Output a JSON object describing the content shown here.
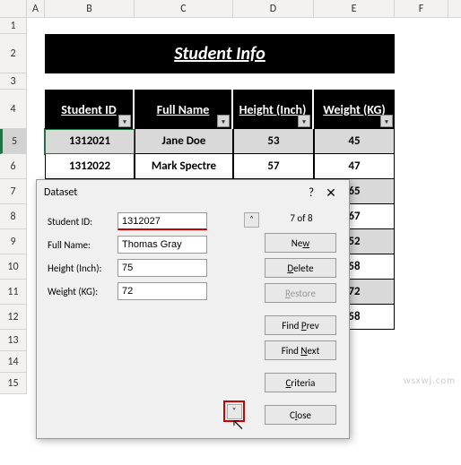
{
  "columns": [
    "A",
    "B",
    "C",
    "D",
    "E",
    "F"
  ],
  "rows": [
    "1",
    "2",
    "3",
    "4",
    "5",
    "6",
    "7",
    "8",
    "9",
    "10",
    "11",
    "12",
    "13",
    "14",
    "15"
  ],
  "title": "Student Info",
  "headers": {
    "b": "Student ID",
    "c": "Full Name",
    "d": "Height (Inch)",
    "e": "Weight (KG)"
  },
  "table": [
    {
      "id": "1312021",
      "name": "Jane Doe",
      "h": "53",
      "w": "45"
    },
    {
      "id": "1312022",
      "name": "Mark Spectre",
      "h": "57",
      "w": "47"
    },
    {
      "id": "",
      "name": "",
      "h": "",
      "w": "65"
    },
    {
      "id": "",
      "name": "",
      "h": "",
      "w": "67"
    },
    {
      "id": "",
      "name": "",
      "h": "",
      "w": "52"
    },
    {
      "id": "",
      "name": "",
      "h": "",
      "w": "58"
    },
    {
      "id": "",
      "name": "",
      "h": "",
      "w": "72"
    },
    {
      "id": "",
      "name": "",
      "h": "",
      "w": "58"
    }
  ],
  "dialog": {
    "title": "Dataset",
    "counter": "7 of 8",
    "fields": {
      "student_id": {
        "label": "Student ID:",
        "value": "1312027"
      },
      "full_name": {
        "label": "Full Name:",
        "value": "Thomas Gray"
      },
      "height": {
        "label": "Height (Inch):",
        "value": "75"
      },
      "weight": {
        "label": "Weight (KG):",
        "value": "72"
      }
    },
    "buttons": {
      "new": "New",
      "delete": "Delete",
      "restore": "Restore",
      "findprev": "Find Prev",
      "findnext": "Find Next",
      "criteria": "Criteria",
      "close": "Close"
    },
    "help": "?",
    "close": "✕",
    "up": "˄",
    "down": "˅"
  },
  "watermark": "wsxwj.com"
}
